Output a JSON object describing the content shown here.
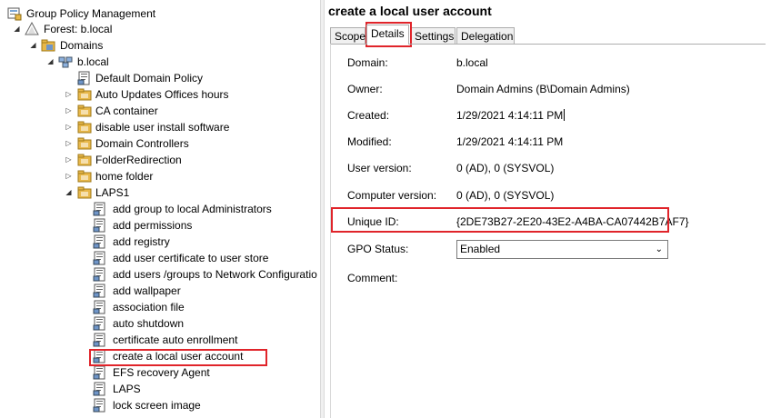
{
  "tree": {
    "root": "Group Policy Management",
    "forest": "Forest: b.local",
    "domains": "Domains",
    "domain": "b.local",
    "policies": [
      {
        "label": "Default Domain Policy",
        "type": "gpo"
      },
      {
        "label": "Auto Updates Offices hours",
        "type": "ou"
      },
      {
        "label": "CA container",
        "type": "ou"
      },
      {
        "label": "disable user install software",
        "type": "ou"
      },
      {
        "label": "Domain Controllers",
        "type": "ou"
      },
      {
        "label": "FolderRedirection",
        "type": "ou"
      },
      {
        "label": "home folder",
        "type": "ou"
      },
      {
        "label": "LAPS1",
        "type": "ou-open"
      }
    ],
    "laps_children": [
      "add group to local Administrators",
      "add permissions",
      "add registry",
      "add user certificate to user store",
      "add users /groups to Network Configuratio",
      "add wallpaper",
      "association file",
      "auto shutdown",
      "certificate auto enrollment",
      "create a local user account",
      "EFS recovery Agent",
      "LAPS",
      "lock screen image"
    ],
    "selected_index": 9
  },
  "details": {
    "title": "create a local user account",
    "tabs": [
      "Scope",
      "Details",
      "Settings",
      "Delegation"
    ],
    "active_tab": "Details",
    "fields": {
      "domain_label": "Domain:",
      "domain": "b.local",
      "owner_label": "Owner:",
      "owner": "Domain Admins (B\\Domain Admins)",
      "created_label": "Created:",
      "created": "1/29/2021 4:14:11 PM",
      "modified_label": "Modified:",
      "modified": "1/29/2021 4:14:11 PM",
      "user_version_label": "User version:",
      "user_version": "0 (AD), 0 (SYSVOL)",
      "computer_version_label": "Computer version:",
      "computer_version": "0 (AD), 0 (SYSVOL)",
      "unique_id_label": "Unique ID:",
      "unique_id": "{2DE73B27-2E20-43E2-A4BA-CA07442B7AF7}",
      "gpo_status_label": "GPO Status:",
      "gpo_status": "Enabled",
      "comment_label": "Comment:"
    }
  },
  "colors": {
    "highlight": "#e0242a",
    "folder": "#e8b84a",
    "border": "#adadad"
  }
}
